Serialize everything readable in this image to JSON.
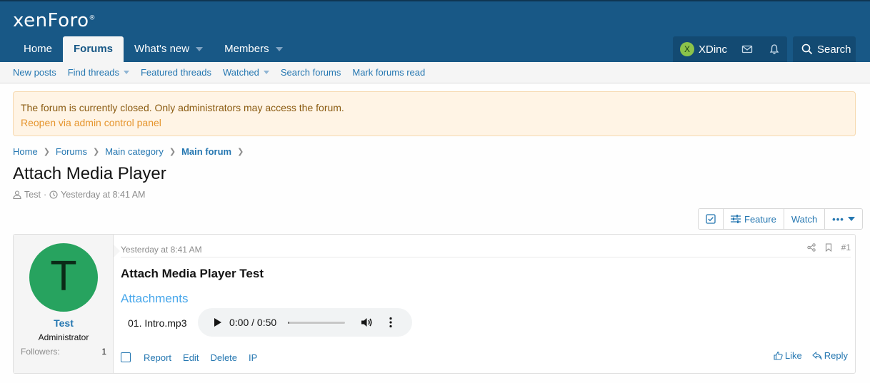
{
  "header": {
    "logo_text": "xenForo",
    "logo_mark": "®",
    "nav": [
      {
        "label": "Home",
        "active": false,
        "dropdown": false
      },
      {
        "label": "Forums",
        "active": true,
        "dropdown": false
      },
      {
        "label": "What's new",
        "active": false,
        "dropdown": true
      },
      {
        "label": "Members",
        "active": false,
        "dropdown": true
      }
    ],
    "user": {
      "initial": "X",
      "name": "XDinc"
    },
    "search_label": "Search"
  },
  "subnav": [
    {
      "label": "New posts"
    },
    {
      "label": "Find threads"
    },
    {
      "label": "Featured threads"
    },
    {
      "label": "Watched"
    },
    {
      "label": "Search forums"
    },
    {
      "label": "Mark forums read"
    }
  ],
  "notice": {
    "text": "The forum is currently closed. Only administrators may access the forum.",
    "link": "Reopen via admin control panel"
  },
  "breadcrumb": [
    "Home",
    "Forums",
    "Main category",
    "Main forum"
  ],
  "thread": {
    "title": "Attach Media Player",
    "author": "Test",
    "date": "Yesterday at 8:41 AM",
    "separator": "·"
  },
  "actions": {
    "feature": "Feature",
    "watch": "Watch"
  },
  "post": {
    "avatar_initial": "T",
    "username": "Test",
    "user_title": "Administrator",
    "followers_label": "Followers:",
    "followers_value": "1",
    "date": "Yesterday at 8:41 AM",
    "number": "#1",
    "heading": "Attach Media Player Test",
    "attachments_title": "Attachments",
    "attachment": {
      "file_name": "01. Intro.mp3",
      "time": "0:00 / 0:50",
      "progress": 0.02
    },
    "footer_links": [
      "Report",
      "Edit",
      "Delete",
      "IP"
    ],
    "like": "Like",
    "reply": "Reply"
  },
  "colors": {
    "header": "#185886",
    "link": "#2577b1",
    "notice_bg": "#fff4e5",
    "avatar_post": "#27a35f",
    "avatar_user": "#8bc34a"
  }
}
